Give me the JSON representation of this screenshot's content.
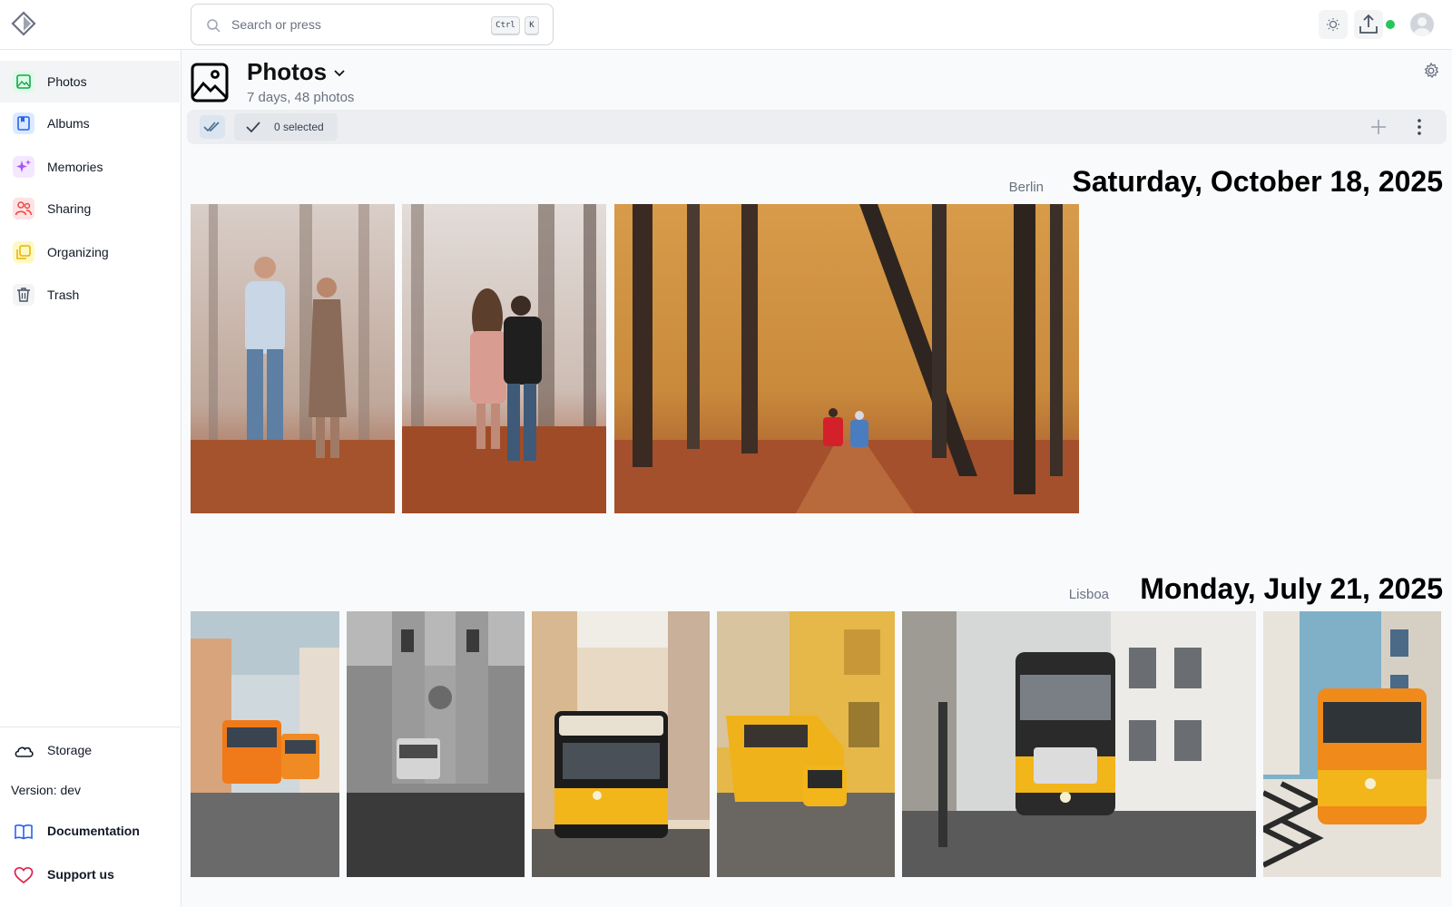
{
  "search": {
    "placeholder": "Search or press",
    "shortcut_ctrl": "Ctrl",
    "shortcut_key": "K"
  },
  "sidebar": {
    "items": [
      {
        "label": "Photos",
        "icon": "photos-icon",
        "color": "#16a34a",
        "active": true
      },
      {
        "label": "Albums",
        "icon": "albums-icon",
        "color": "#2563eb"
      },
      {
        "label": "Memories",
        "icon": "memories-icon",
        "color": "#a855f7"
      },
      {
        "label": "Sharing",
        "icon": "sharing-icon",
        "color": "#ef4444"
      },
      {
        "label": "Organizing",
        "icon": "organizing-icon",
        "color": "#eab308"
      },
      {
        "label": "Trash",
        "icon": "trash-icon",
        "color": "#4b5563"
      }
    ],
    "storage_label": "Storage",
    "version_label": "Version: dev",
    "documentation_label": "Documentation",
    "support_label": "Support us"
  },
  "header": {
    "title": "Photos",
    "subtitle": "7 days, 48 photos"
  },
  "toolbar": {
    "selected_label": "0 selected"
  },
  "groups": [
    {
      "location": "Berlin",
      "date": "Saturday, October 18, 2025",
      "photos": [
        "couple-forest-photo",
        "couple-walking-photo",
        "autumn-forest-path-photo"
      ]
    },
    {
      "location": "Lisboa",
      "date": "Monday, July 21, 2025",
      "photos": [
        "tram-hill-photo",
        "cathedral-bw-photo",
        "yellow-tram-street-photo",
        "tram-yellow-wall-photo",
        "tram-front-photo",
        "tram-mosaic-sidewalk-photo"
      ]
    }
  ],
  "colors": {
    "accent_green": "#22c55e",
    "status_online": "#22c55e"
  }
}
